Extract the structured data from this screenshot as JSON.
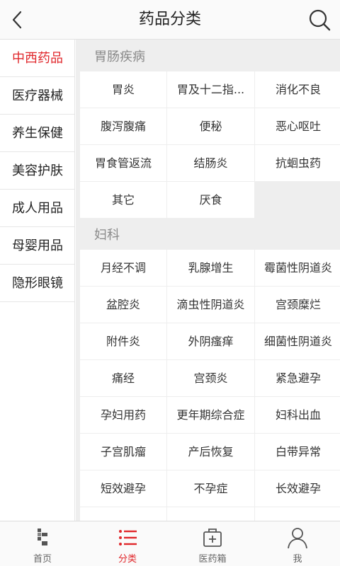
{
  "header": {
    "title": "药品分类",
    "back_icon": "back-arrow-icon",
    "search_icon": "search-icon"
  },
  "sidebar": {
    "items": [
      {
        "label": "中西药品",
        "active": true
      },
      {
        "label": "医疗器械",
        "active": false
      },
      {
        "label": "养生保健",
        "active": false
      },
      {
        "label": "美容护肤",
        "active": false
      },
      {
        "label": "成人用品",
        "active": false
      },
      {
        "label": "母婴用品",
        "active": false
      },
      {
        "label": "隐形眼镜",
        "active": false
      }
    ]
  },
  "sections": [
    {
      "title": "胃肠疾病",
      "items": [
        "胃炎",
        "胃及十二指...",
        "消化不良",
        "腹泻腹痛",
        "便秘",
        "恶心呕吐",
        "胃食管返流",
        "结肠炎",
        "抗蛔虫药",
        "其它",
        "厌食"
      ]
    },
    {
      "title": "妇科",
      "items": [
        "月经不调",
        "乳腺增生",
        "霉菌性阴道炎",
        "盆腔炎",
        "滴虫性阴道炎",
        "宫颈糜烂",
        "附件炎",
        "外阴瘙痒",
        "细菌性阴道炎",
        "痛经",
        "宫颈炎",
        "紧急避孕",
        "孕妇用药",
        "更年期综合症",
        "妇科出血",
        "子宫肌瘤",
        "产后恢复",
        "白带异常",
        "短效避孕",
        "不孕症",
        "长效避孕"
      ]
    }
  ],
  "tabbar": {
    "tabs": [
      {
        "label": "首页",
        "icon": "home-icon",
        "active": false
      },
      {
        "label": "分类",
        "icon": "category-list-icon",
        "active": true
      },
      {
        "label": "医药箱",
        "icon": "medicine-box-icon",
        "active": false
      },
      {
        "label": "我",
        "icon": "user-icon",
        "active": false
      }
    ]
  },
  "colors": {
    "accent": "#e0262a",
    "background": "#eeeeee",
    "text": "#333333",
    "section_title": "#8a8a8a"
  }
}
